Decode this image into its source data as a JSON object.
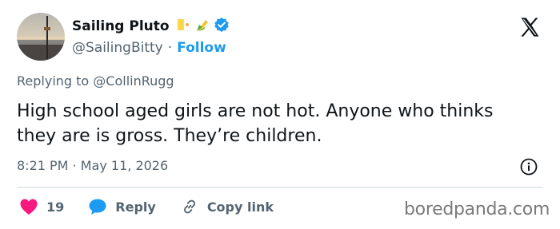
{
  "tweet": {
    "display_name": "Sailing Pluto",
    "name_emojis": [
      "pineapple-flag-icon",
      "corn-icon"
    ],
    "handle": "@SailingBitty",
    "separator": "·",
    "follow_label": "Follow",
    "replying_prefix": "Replying to",
    "replying_to": "@CollinRugg",
    "text": "High school aged girls are not hot. Anyone who thinks they are is gross. They’re children.",
    "time": "8:21 PM",
    "date_separator": "·",
    "date": "May 11, 2026",
    "like_count": "19",
    "reply_label": "Reply",
    "copy_link_label": "Copy link"
  },
  "watermark": "boredpanda.com",
  "colors": {
    "accent": "#1d9bf0",
    "like": "#f91880",
    "muted": "#536471",
    "text": "#0f1419"
  }
}
